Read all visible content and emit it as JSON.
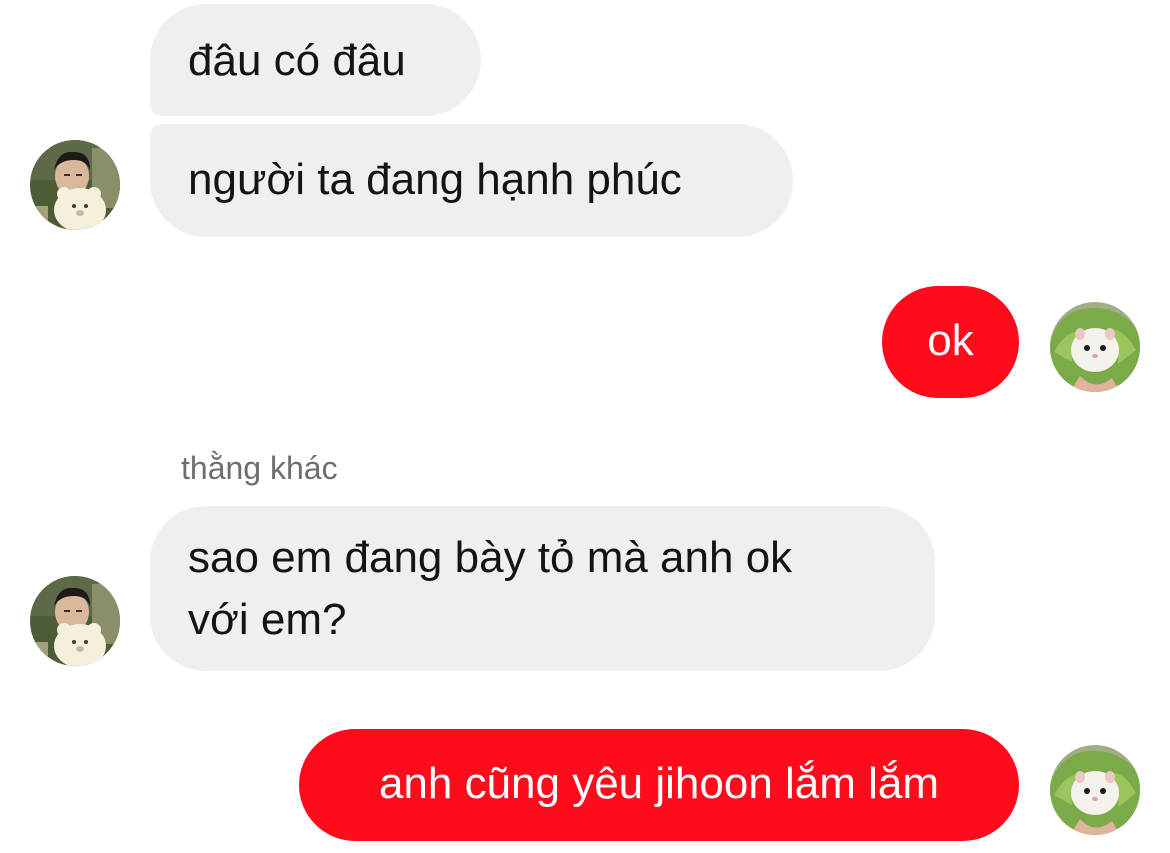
{
  "conversation": {
    "messages": [
      {
        "text": "đâu có đâu",
        "from": "other"
      },
      {
        "text": "người ta đang hạnh phúc",
        "from": "other"
      },
      {
        "text": "ok",
        "from": "me"
      },
      {
        "text": "sao em đang bày tỏ mà anh ok",
        "text_line2": "với em?",
        "from": "other"
      },
      {
        "text": "anh cũng yêu jihoon lắm lắm",
        "from": "me"
      }
    ],
    "sender_label": "thằng khác"
  },
  "colors": {
    "incoming_bubble": "#efeff2",
    "outgoing_bubble": "#ff0c1c",
    "incoming_text": "#141414",
    "outgoing_text": "#ffffff"
  },
  "icons": {
    "other_avatar": "child-with-teddy-bear-avatar",
    "my_avatar": "hamster-in-lettuce-avatar"
  }
}
